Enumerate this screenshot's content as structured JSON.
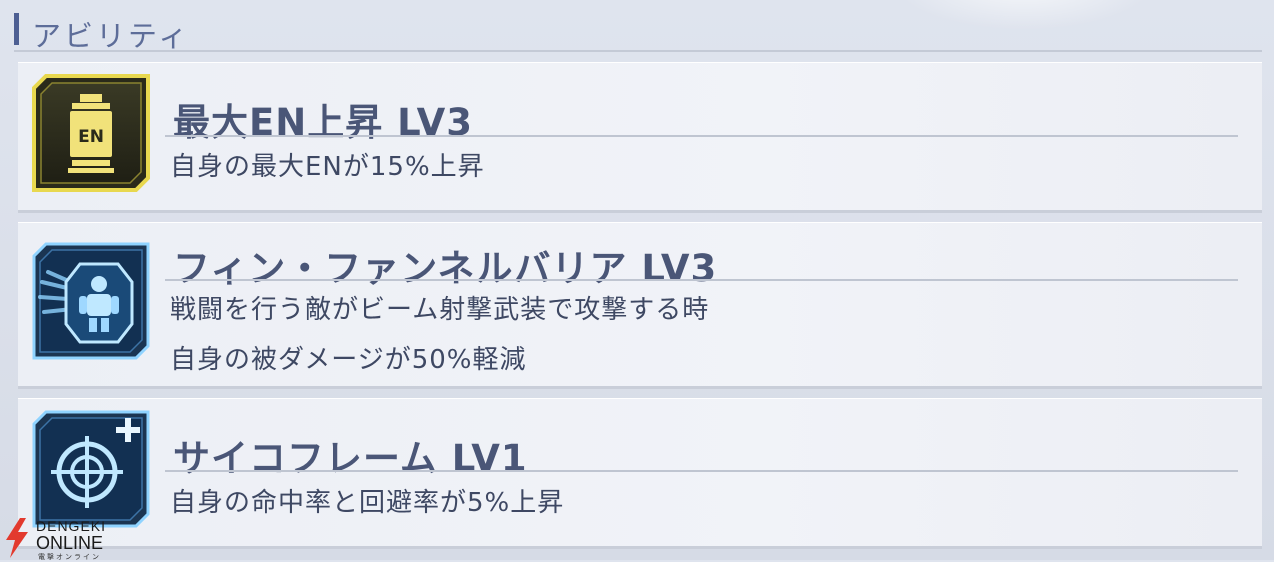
{
  "section": {
    "title": "アビリティ"
  },
  "abilities": [
    {
      "icon": "en-canister-icon",
      "title": "最大EN上昇 LV3",
      "icon_label": "EN",
      "description": [
        "自身の最大ENが15%上昇"
      ]
    },
    {
      "icon": "fin-funnel-barrier-icon",
      "title": "フィン・ファンネルバリア LV3",
      "description": [
        "戦闘を行う敵がビーム射撃武装で攻撃する時",
        "自身の被ダメージが50%軽減"
      ]
    },
    {
      "icon": "crosshair-plus-icon",
      "title": "サイコフレーム LV1",
      "description": [
        "自身の命中率と回避率が5%上昇"
      ]
    }
  ],
  "watermark": {
    "line1": "DENGEKI",
    "line2": "ONLINE",
    "line3": "電撃オンライン"
  },
  "colors": {
    "en_icon": "#f1e27a",
    "blue_icon": "#8fd3ff",
    "title": "#4a5677",
    "section_bar": "#4d5f93"
  }
}
